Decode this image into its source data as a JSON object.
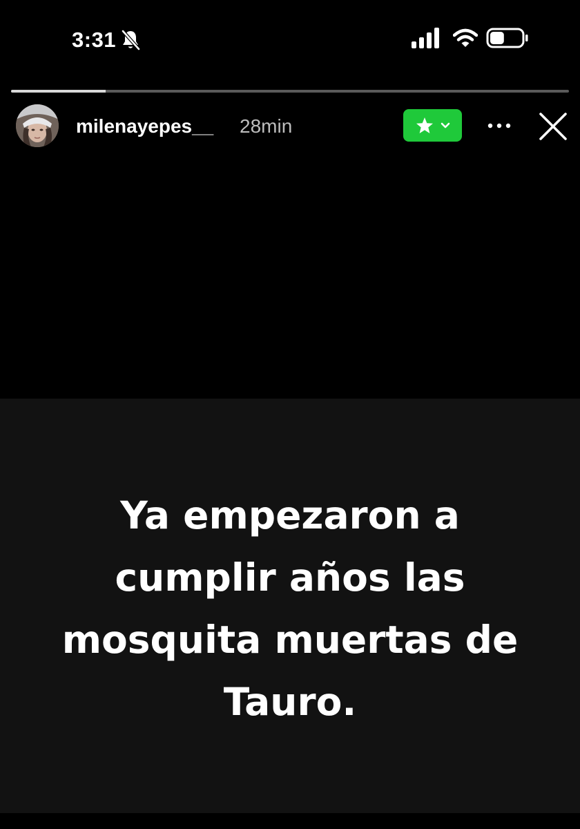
{
  "status_bar": {
    "time": "3:31",
    "icons": [
      "bell-muted-icon",
      "signal-icon",
      "wifi-icon",
      "battery-icon"
    ],
    "battery_level": 0.45
  },
  "story_progress": {
    "segments": 1,
    "current_progress": 0.17
  },
  "header": {
    "username": "milenayepes__",
    "time_ago": "28min",
    "close_friends_icon": "star-icon",
    "close_friends_color": "#1fc93a",
    "more_icon": "more-dots-icon",
    "close_icon": "close-icon"
  },
  "story": {
    "background": "#121212",
    "text": "Ya empezaron a\ncumplir años las\nmosquita muertas de\nTauro."
  }
}
